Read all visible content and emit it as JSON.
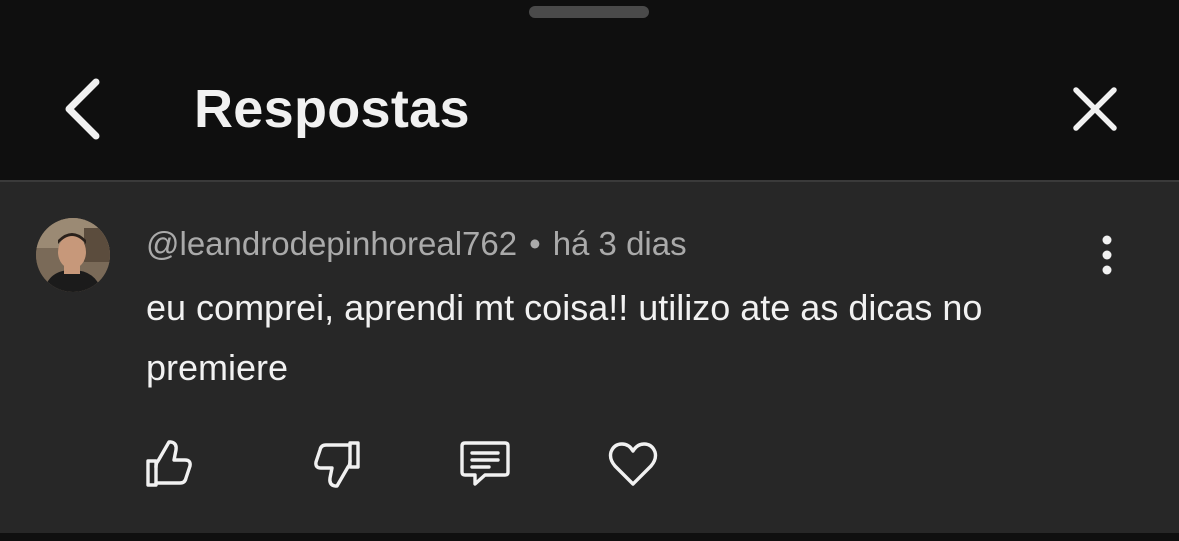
{
  "header": {
    "title": "Respostas"
  },
  "comment": {
    "author": "@leandrodepinhoreal762",
    "separator": "•",
    "time": "há 3 dias",
    "text": "eu comprei, aprendi mt coisa!! utilizo ate as dicas no premiere",
    "actions": [
      "like-icon",
      "dislike-icon",
      "reply-icon",
      "heart-icon"
    ]
  },
  "colors": {
    "header_bg": "#0f0f0f",
    "comment_bg": "#272727",
    "primary_text": "#f1f1f1",
    "secondary_text": "#aaaaaa"
  }
}
